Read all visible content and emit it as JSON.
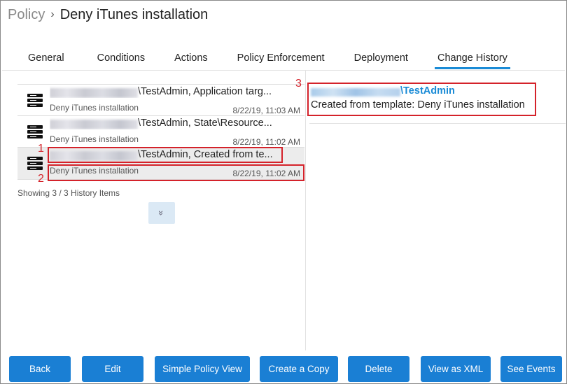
{
  "breadcrumb": {
    "parent": "Policy",
    "separator": "›",
    "title": "Deny iTunes installation"
  },
  "tabs": [
    {
      "label": "General"
    },
    {
      "label": "Conditions"
    },
    {
      "label": "Actions"
    },
    {
      "label": "Policy Enforcement"
    },
    {
      "label": "Deployment"
    },
    {
      "label": "Change History",
      "active": true
    }
  ],
  "history": {
    "items": [
      {
        "icon": "server-icon",
        "line1": "\\TestAdmin, Application targ...",
        "policy": "Deny iTunes installation",
        "time": "8/22/19, 11:03 AM",
        "selected": false
      },
      {
        "icon": "server-icon",
        "line1": "\\TestAdmin, State\\Resource...",
        "policy": "Deny iTunes installation",
        "time": "8/22/19, 11:02 AM",
        "selected": false
      },
      {
        "icon": "server-icon",
        "line1": "\\TestAdmin, Created from te...",
        "policy": "Deny iTunes installation",
        "time": "8/22/19, 11:02 AM",
        "selected": true
      }
    ],
    "showing": "Showing 3 / 3 History Items",
    "expand_icon": "double-chevron-down-icon",
    "expand_glyph": "»"
  },
  "detail": {
    "user": "\\TestAdmin",
    "description": "Created from template: Deny iTunes installation"
  },
  "annotations": [
    {
      "num": "1"
    },
    {
      "num": "2"
    },
    {
      "num": "3"
    }
  ],
  "footer": {
    "back": "Back",
    "edit": "Edit",
    "simple_policy_view": "Simple Policy View",
    "create_copy": "Create a Copy",
    "delete": "Delete",
    "view_xml": "View as XML",
    "see_events": "See Events"
  },
  "colors": {
    "accent": "#1a7fd4",
    "link": "#1a8bd6",
    "annotation": "#d4222a",
    "selected_row": "#ececec"
  }
}
